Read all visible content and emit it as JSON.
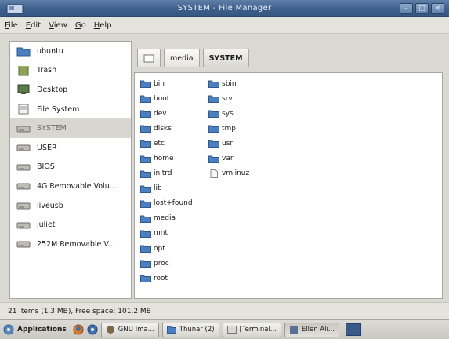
{
  "window": {
    "title": "SYSTEM - File Manager"
  },
  "menubar": {
    "items": [
      "File",
      "Edit",
      "View",
      "Go",
      "Help"
    ]
  },
  "sidebar": {
    "items": [
      {
        "label": "ubuntu",
        "icon": "folder-icon"
      },
      {
        "label": "Trash",
        "icon": "trash-icon"
      },
      {
        "label": "Desktop",
        "icon": "desktop-icon"
      },
      {
        "label": "File System",
        "icon": "filesystem-icon"
      },
      {
        "label": "SYSTEM",
        "icon": "drive-icon",
        "active": true
      },
      {
        "label": "USER",
        "icon": "drive-icon"
      },
      {
        "label": "BIOS",
        "icon": "drive-icon"
      },
      {
        "label": "4G Removable Volu...",
        "icon": "drive-icon"
      },
      {
        "label": "liveusb",
        "icon": "drive-icon"
      },
      {
        "label": "juliet",
        "icon": "drive-icon"
      },
      {
        "label": "252M Removable V...",
        "icon": "drive-icon"
      }
    ]
  },
  "pathbar": {
    "items": [
      "media",
      "SYSTEM"
    ]
  },
  "files": {
    "col1": [
      "bin",
      "boot",
      "dev",
      "disks",
      "etc",
      "home",
      "initrd",
      "lib",
      "lost+found",
      "media",
      "mnt",
      "opt",
      "proc",
      "root"
    ],
    "col2": [
      "sbin",
      "srv",
      "sys",
      "tmp",
      "usr",
      "var",
      "vmlinuz"
    ]
  },
  "status": {
    "text": "21 items (1.3 MB), Free space: 101.2 MB"
  },
  "taskbar": {
    "applications_label": "Applications",
    "tasks": [
      "GNU Ima...",
      "Thunar (2)",
      "[Terminal...",
      "Ellen Ali..."
    ]
  },
  "colors": {
    "titlebar": "#3d5f8c",
    "folder": "#4a7fc0",
    "selection": "#d8d6d0"
  }
}
